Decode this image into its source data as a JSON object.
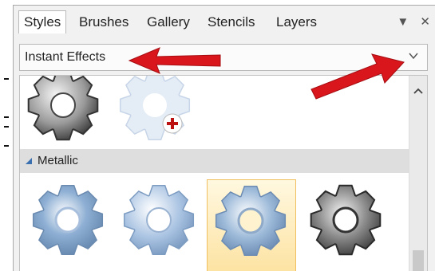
{
  "tabs": [
    {
      "label": "Styles",
      "active": true
    },
    {
      "label": "Brushes",
      "active": false
    },
    {
      "label": "Gallery",
      "active": false
    },
    {
      "label": "Stencils",
      "active": false
    },
    {
      "label": "Layers",
      "active": false
    }
  ],
  "tab_controls": {
    "menu_glyph": "▼",
    "close_glyph": "✕"
  },
  "dropdown": {
    "value": "Instant Effects"
  },
  "section": {
    "label": "Metallic"
  },
  "colors": {
    "accent_red": "#d9161c",
    "selected_gold": "#fde3a3"
  },
  "icons": [
    "gear-style-icon",
    "add-style-icon",
    "chevron-down-icon",
    "scroll-up-icon",
    "collapse-triangle-icon"
  ]
}
